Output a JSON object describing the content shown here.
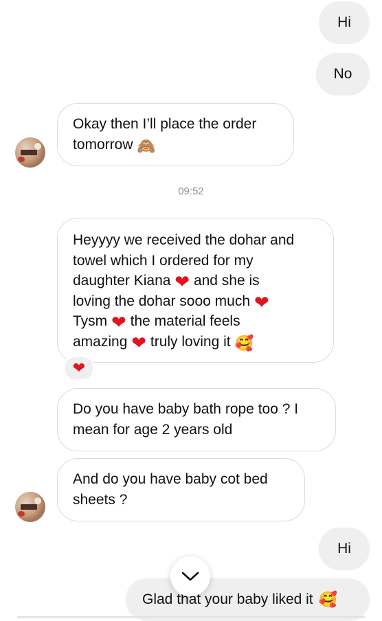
{
  "messages": {
    "m1": {
      "text": "Hi"
    },
    "m2": {
      "text": "No"
    },
    "m3": {
      "line1": "Okay then I’ll place the order",
      "line2": "tomorrow",
      "emoji": "🙈"
    },
    "timestamp": "09:52",
    "m4": {
      "l1": "Heyyyy we received the dohar and",
      "l2": "towel which I ordered for my",
      "l3a": "daughter Kiana",
      "l3b": "and she is",
      "l4": "loving the dohar sooo much",
      "l5a": "Tysm",
      "l5b": "the material feels",
      "l6a": "amazing",
      "l6b": "truly loving it",
      "heart": "❤",
      "smile": "🥰"
    },
    "m4_reaction": "❤",
    "m5": {
      "line1": "Do you have baby bath rope too ? I",
      "line2": "mean for age 2 years old"
    },
    "m6": {
      "line1": "And do you have baby cot bed",
      "line2": "sheets ?"
    },
    "m7": {
      "text": "Hi"
    },
    "m8": {
      "text": "Glad that your baby liked it",
      "emoji": "🥰"
    }
  },
  "icons": {
    "scroll_down": "chevron-down-icon",
    "avatar": "contact-avatar"
  },
  "colors": {
    "outgoing_bubble": "#efefef",
    "incoming_border": "#dbdbdb",
    "heart": "#e0141e",
    "timestamp": "#8e8e8e"
  }
}
